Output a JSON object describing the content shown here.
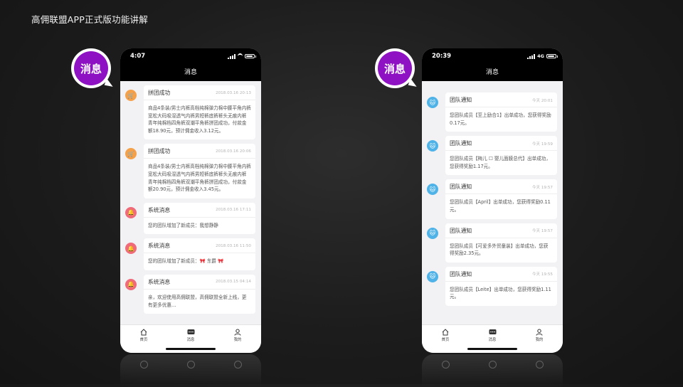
{
  "slide": {
    "title": "高佣联盟APP正式版功能讲解"
  },
  "badge": {
    "label": "消息",
    "color": "#8e12c4"
  },
  "left_phone": {
    "status_time": "4:07",
    "nav_title": "消息",
    "messages": [
      {
        "type": "cart",
        "title": "拼团成功",
        "time": "2018.03.16 20:13",
        "body": "商品4条装/男士内裤高档纯棉弹力棉中腰平角内裤宽松大码吸湿透气内裤男短裤底裤裤头无痕内裤青年纯棉档四角裤双潮平角裤拼团成功，付款金额18.90元，预计佣金收入3.12元。"
      },
      {
        "type": "cart",
        "title": "拼团成功",
        "time": "2018.03.16 20:06",
        "body": "商品4条装/男士内裤高档纯棉弹力棉中腰平角内裤宽松大码吸湿透气内裤男短裤底裤裤头无痕内裤青年纯棉档四角裤双潮平角裤拼团成功，付款金额20.90元，预计佣金收入3.45元。"
      },
      {
        "type": "bell",
        "title": "系统消息",
        "time": "2018.03.16 17:11",
        "body": "您的团队增加了新成员：我想静静"
      },
      {
        "type": "bell",
        "title": "系统消息",
        "time": "2018.03.16 11:50",
        "body": "您的团队增加了新成员：🎀 东爵 🎀"
      },
      {
        "type": "bell",
        "title": "系统消息",
        "time": "2018.03.15 04:14",
        "body": "亲，欢迎使用高佣联盟，高佣联盟全新上线，更有更多优惠…"
      }
    ],
    "tabs": [
      {
        "label": "首页",
        "icon": "home-icon"
      },
      {
        "label": "消息",
        "icon": "message-icon"
      },
      {
        "label": "我的",
        "icon": "person-icon"
      }
    ]
  },
  "right_phone": {
    "status_time": "20:39",
    "network": "4G",
    "nav_title": "消息",
    "messages": [
      {
        "type": "team",
        "title": "团队通知",
        "time": "今天 20:01",
        "body": "您团队成员【至上励合1】出单成功，您获得奖励0.17元。"
      },
      {
        "type": "team",
        "title": "团队通知",
        "time": "今天 19:59",
        "body": "您团队成员【梅儿 ☐ 婴儿面膜总代】出单成功，您获得奖励1.17元。"
      },
      {
        "type": "team",
        "title": "团队通知",
        "time": "今天 19:57",
        "body": "您团队成员【April】出单成功，您获得奖励0.11元。"
      },
      {
        "type": "team",
        "title": "团队通知",
        "time": "今天 19:57",
        "body": "您团队成员【可爱多外贸童装】出单成功，您获得奖励2.35元。"
      },
      {
        "type": "team",
        "title": "团队通知",
        "time": "今天 19:55",
        "body": "您团队成员【Leite】出单成功，您获得奖励1.11元。"
      }
    ],
    "tabs": [
      {
        "label": "首页",
        "icon": "home-icon"
      },
      {
        "label": "消息",
        "icon": "message-icon"
      },
      {
        "label": "我的",
        "icon": "person-icon"
      }
    ]
  }
}
